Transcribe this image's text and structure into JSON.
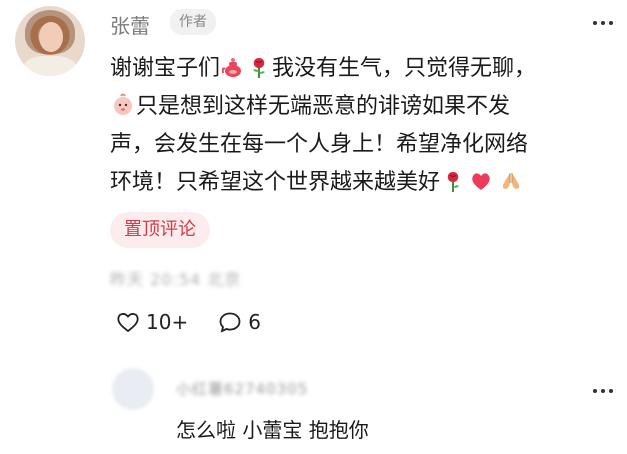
{
  "comment": {
    "author": "张蕾",
    "badge": "作者",
    "line1_a": "谢谢宝子们",
    "line1_b": "我没有生气，只觉得无聊，",
    "line2_a": "只是想到这样无端恶意的诽谤如果不发",
    "line3": "声，会发生在每一个人身上！希望净化网络",
    "line4_a": "环境！只希望这个世界越来越美好",
    "pin_label": "置顶评论",
    "time_blurred": "昨天 20:54 北京",
    "likes": "10+",
    "replies": "6",
    "emoji": [
      "teapot-emoji",
      "rose-emoji",
      "baby-face-emoji",
      "rose-emoji",
      "heart-emoji",
      "pray-hands-emoji"
    ]
  },
  "reply": {
    "name_blurred": "小红薯62740305",
    "text": "怎么啦 小蕾宝 抱抱你"
  },
  "colors": {
    "accent": "#d43b4b",
    "pin_bg": "#fdecee",
    "muted": "#7b7b7b"
  },
  "icons": [
    "more-icon",
    "heart-outline-icon",
    "comment-bubble-icon"
  ]
}
